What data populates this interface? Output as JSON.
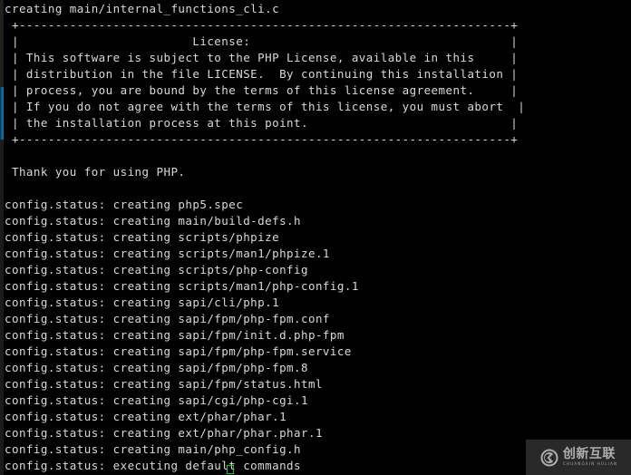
{
  "terminal": {
    "background_color": "#000000",
    "text_color": "#d9d9d9",
    "cursor_color": "#2fb62f",
    "lines": [
      "creating main/internal_functions_cli.c",
      " +--------------------------------------------------------------------+",
      " |                        License:                                    |",
      " | This software is subject to the PHP License, available in this     |",
      " | distribution in the file LICENSE.  By continuing this installation |",
      " | process, you are bound by the terms of this license agreement.     |",
      " | If you do not agree with the terms of this license, you must abort  |",
      " | the installation process at this point.                            |",
      " +--------------------------------------------------------------------+",
      "",
      " Thank you for using PHP.",
      "",
      "config.status: creating php5.spec",
      "config.status: creating main/build-defs.h",
      "config.status: creating scripts/phpize",
      "config.status: creating scripts/man1/phpize.1",
      "config.status: creating scripts/php-config",
      "config.status: creating scripts/man1/php-config.1",
      "config.status: creating sapi/cli/php.1",
      "config.status: creating sapi/fpm/php-fpm.conf",
      "config.status: creating sapi/fpm/init.d.php-fpm",
      "config.status: creating sapi/fpm/php-fpm.service",
      "config.status: creating sapi/fpm/php-fpm.8",
      "config.status: creating sapi/fpm/status.html",
      "config.status: creating sapi/cgi/php-cgi.1",
      "config.status: creating ext/phar/phar.1",
      "config.status: creating ext/phar/phar.phar.1",
      "config.status: creating main/php_config.h",
      "config.status: executing default commands"
    ]
  },
  "watermark": {
    "cn_text": "创新互联",
    "en_text": "CHUANGXIN HULIAN",
    "logo_name": "cx-logo-icon"
  }
}
